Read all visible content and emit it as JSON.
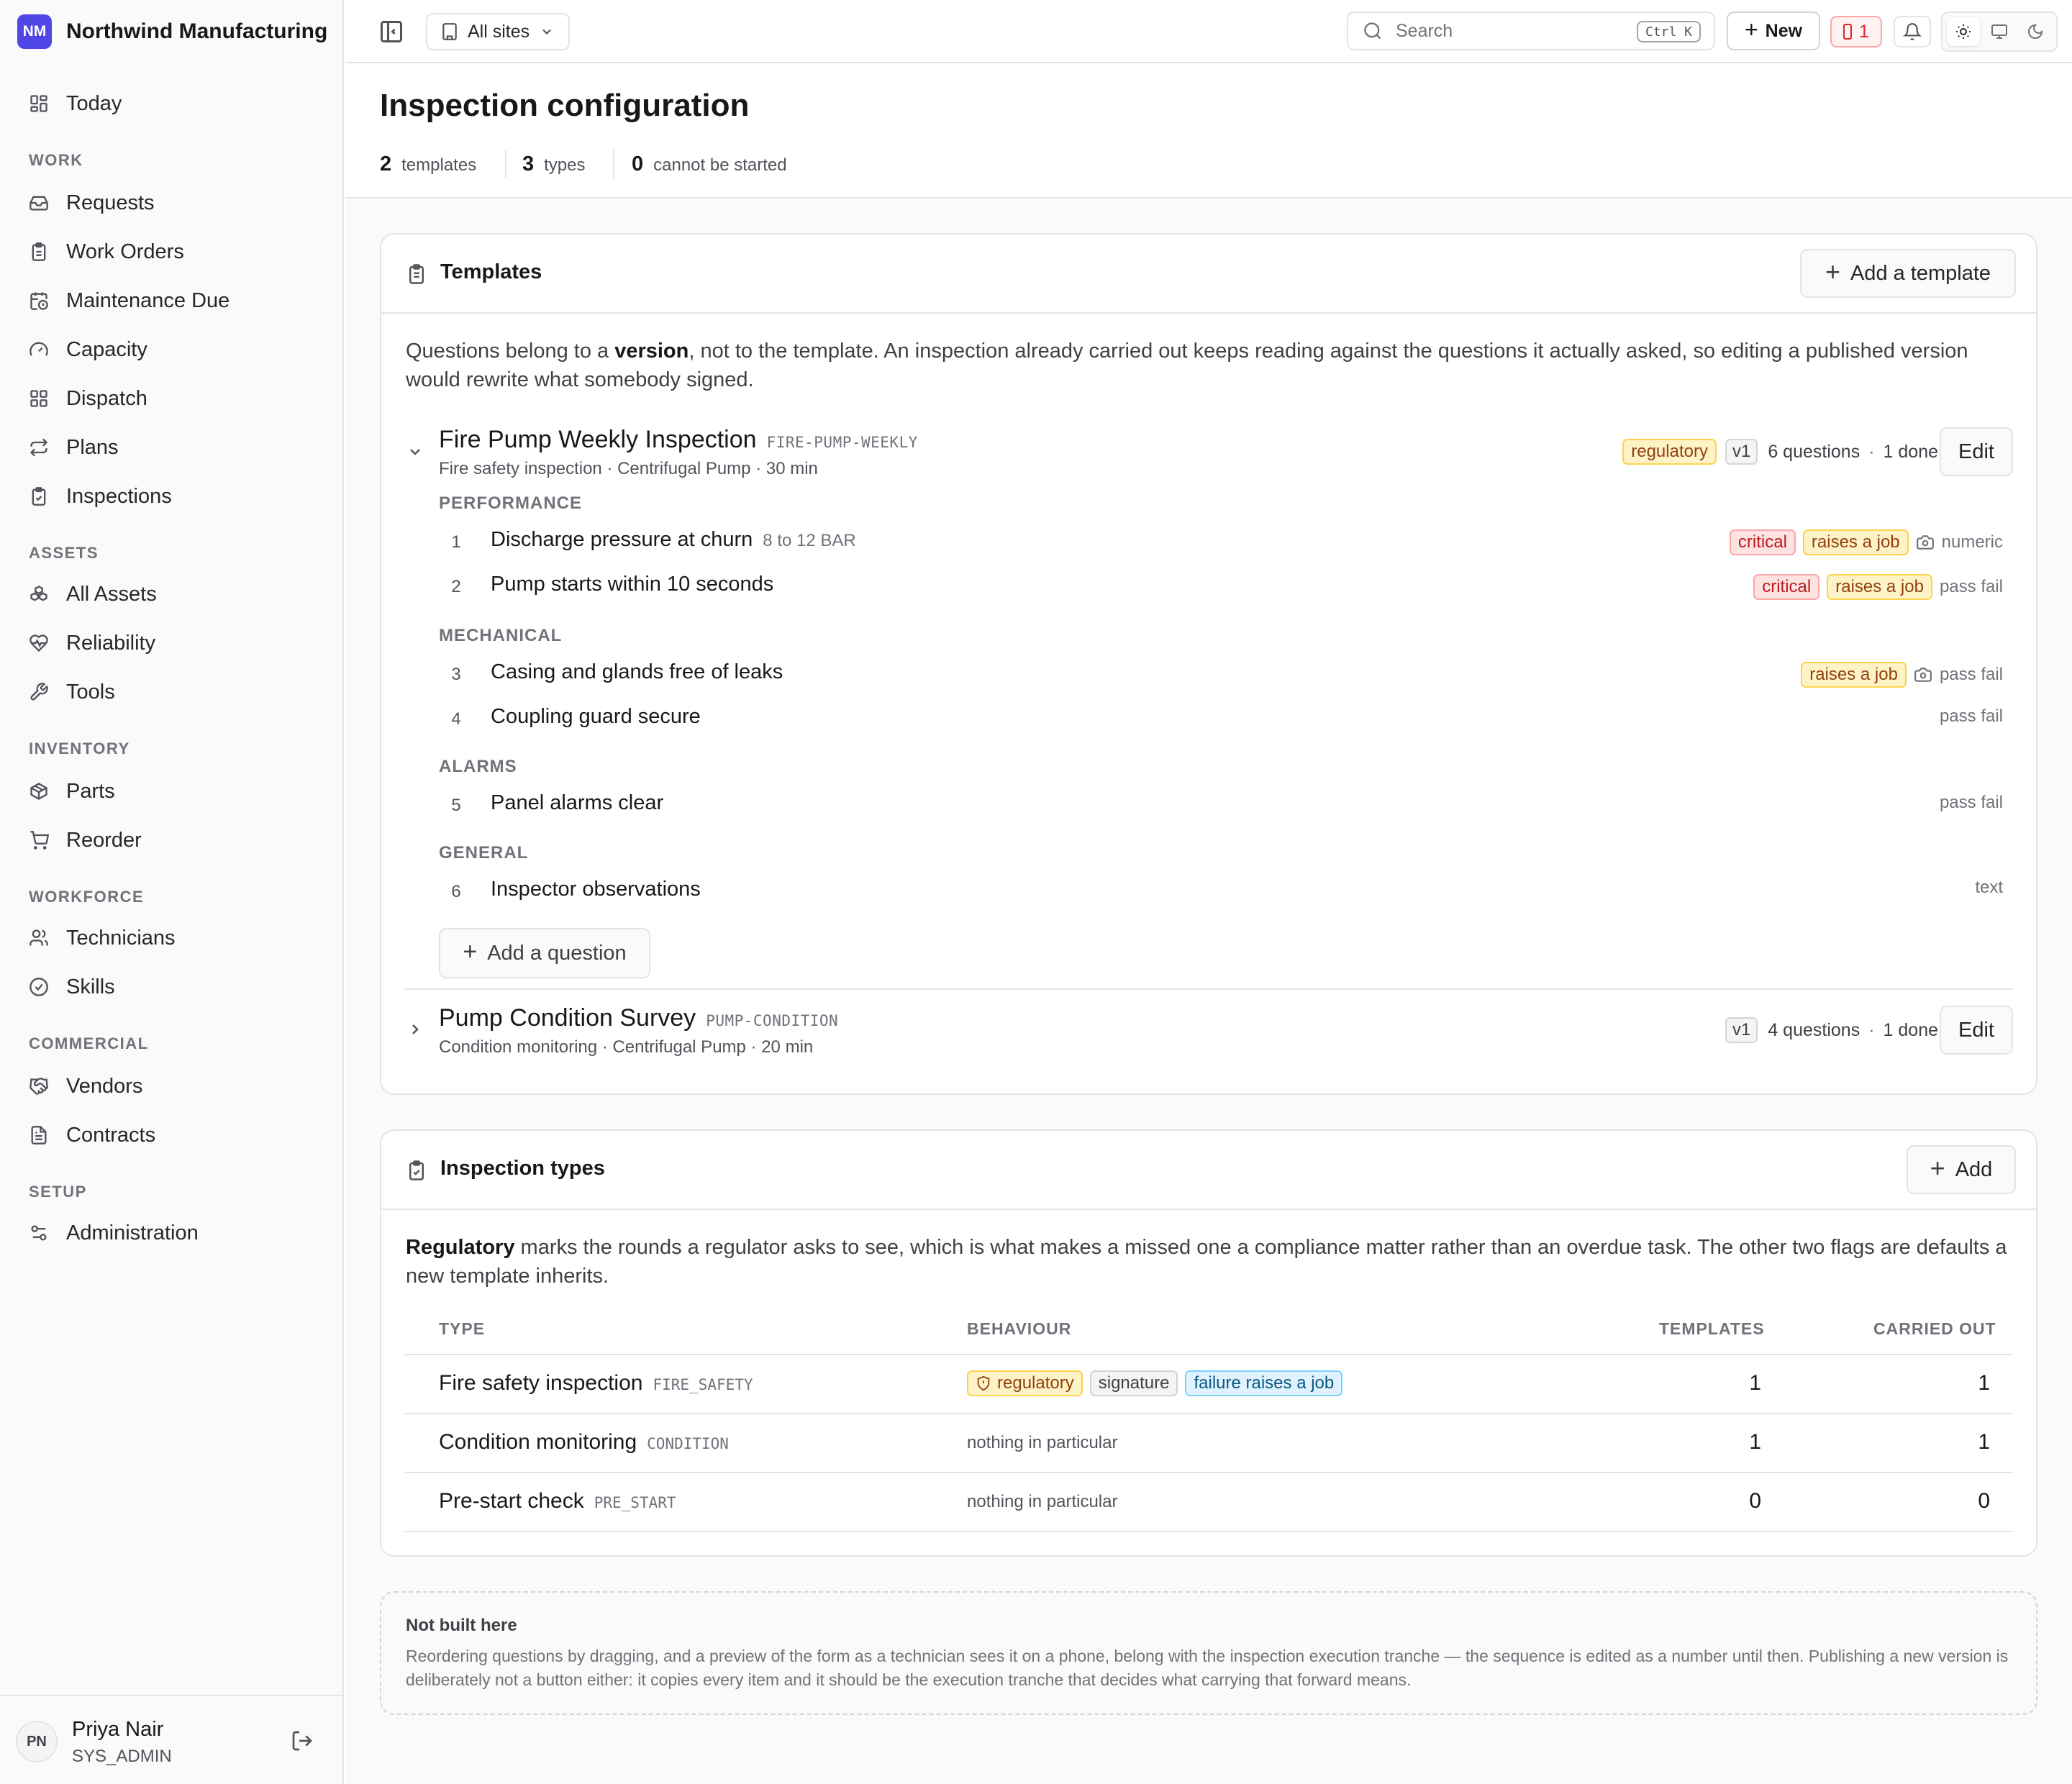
{
  "brand": {
    "initials": "NM",
    "name": "Northwind Manufacturing",
    "color": "#4f46e5"
  },
  "sidebar": {
    "today": "Today",
    "sections": {
      "work": "WORK",
      "assets": "ASSETS",
      "inventory": "INVENTORY",
      "workforce": "WORKFORCE",
      "commercial": "COMMERCIAL",
      "setup": "SETUP"
    },
    "items": {
      "requests": "Requests",
      "work_orders": "Work Orders",
      "maintenance_due": "Maintenance Due",
      "capacity": "Capacity",
      "dispatch": "Dispatch",
      "plans": "Plans",
      "inspections": "Inspections",
      "all_assets": "All Assets",
      "reliability": "Reliability",
      "tools": "Tools",
      "parts": "Parts",
      "reorder": "Reorder",
      "technicians": "Technicians",
      "skills": "Skills",
      "vendors": "Vendors",
      "contracts": "Contracts",
      "administration": "Administration"
    },
    "user": {
      "initials": "PN",
      "name": "Priya Nair",
      "role": "SYS_ADMIN"
    }
  },
  "topbar": {
    "site_select": "All sites",
    "search_placeholder": "Search",
    "search_shortcut": "Ctrl K",
    "new_label": "New",
    "alert_count": "1"
  },
  "header": {
    "title": "Inspection configuration",
    "stats": [
      {
        "value": "2",
        "label": "templates"
      },
      {
        "value": "3",
        "label": "types"
      },
      {
        "value": "0",
        "label": "cannot be started"
      }
    ]
  },
  "templates_card": {
    "title": "Templates",
    "add_label": "Add a template",
    "intro_pre": "Questions belong to a ",
    "intro_bold": "version",
    "intro_post": ", not to the template. An inspection already carried out keeps reading against the questions it actually asked, so editing a published version would rewrite what somebody signed.",
    "templates": [
      {
        "name": "Fire Pump Weekly Inspection",
        "code": "FIRE-PUMP-WEEKLY",
        "subtitle": "Fire safety inspection · Centrifugal Pump · 30 min",
        "badge": "regulatory",
        "version": "v1",
        "questions": "6 questions",
        "done": "1 done",
        "edit": "Edit",
        "groups": [
          "PERFORMANCE",
          "MECHANICAL",
          "ALARMS",
          "GENERAL"
        ],
        "items": [
          {
            "n": "1",
            "text": "Discharge pressure at churn",
            "range": "8 to 12 BAR",
            "critical": "critical",
            "raises": "raises a job",
            "kind": "numeric"
          },
          {
            "n": "2",
            "text": "Pump starts within 10 seconds",
            "critical": "critical",
            "raises": "raises a job",
            "kind": "pass fail"
          },
          {
            "n": "3",
            "text": "Casing and glands free of leaks",
            "raises": "raises a job",
            "kind": "pass fail"
          },
          {
            "n": "4",
            "text": "Coupling guard secure",
            "kind": "pass fail"
          },
          {
            "n": "5",
            "text": "Panel alarms clear",
            "kind": "pass fail"
          },
          {
            "n": "6",
            "text": "Inspector observations",
            "kind": "text"
          }
        ],
        "add_question": "Add a question"
      },
      {
        "name": "Pump Condition Survey",
        "code": "PUMP-CONDITION",
        "subtitle": "Condition monitoring · Centrifugal Pump · 20 min",
        "version": "v1",
        "questions": "4 questions",
        "done": "1 done",
        "edit": "Edit"
      }
    ]
  },
  "types_card": {
    "title": "Inspection types",
    "add_label": "Add",
    "intro_bold": "Regulatory",
    "intro_post": " marks the rounds a regulator asks to see, which is what makes a missed one a compliance matter rather than an overdue task. The other two flags are defaults a new template inherits.",
    "columns": [
      "TYPE",
      "BEHAVIOUR",
      "TEMPLATES",
      "CARRIED OUT"
    ],
    "rows": [
      {
        "name": "Fire safety inspection",
        "code": "FIRE_SAFETY",
        "badges": [
          "regulatory",
          "signature",
          "failure raises a job"
        ],
        "templates": "1",
        "carried": "1"
      },
      {
        "name": "Condition monitoring",
        "code": "CONDITION",
        "behaviour": "nothing in particular",
        "templates": "1",
        "carried": "1"
      },
      {
        "name": "Pre-start check",
        "code": "PRE_START",
        "behaviour": "nothing in particular",
        "templates": "0",
        "carried": "0"
      }
    ]
  },
  "note": {
    "title": "Not built here",
    "body": "Reordering questions by dragging, and a preview of the form as a technician sees it on a phone, belong with the inspection execution tranche — the sequence is edited as a number until then. Publishing a new version is deliberately not a button either: it copies every item and it should be the execution tranche that decides what carrying that forward means."
  }
}
